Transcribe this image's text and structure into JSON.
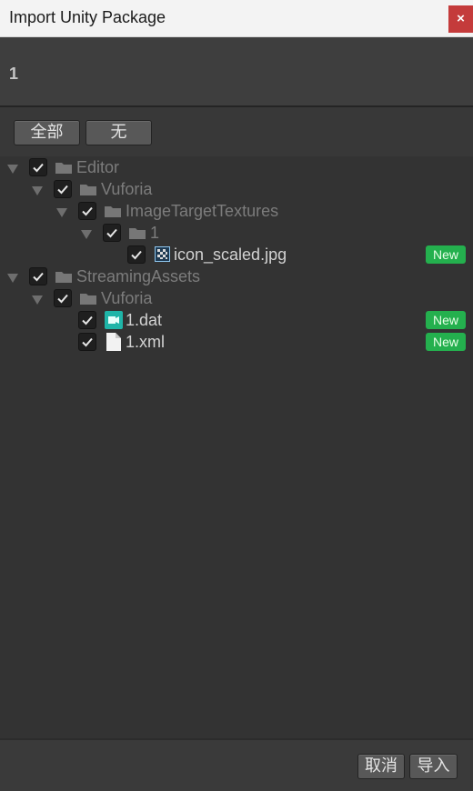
{
  "window": {
    "title": "Import Unity Package",
    "close_label": "×"
  },
  "header": {
    "package_name": "1"
  },
  "select": {
    "all_label": "全部",
    "none_label": "无"
  },
  "tree": {
    "items": [
      {
        "label": "Editor",
        "type": "folder",
        "checked": true
      },
      {
        "label": "Vuforia",
        "type": "folder",
        "checked": true
      },
      {
        "label": "ImageTargetTextures",
        "type": "folder",
        "checked": true
      },
      {
        "label": "1",
        "type": "folder",
        "checked": true
      },
      {
        "label": "icon_scaled.jpg",
        "type": "image",
        "checked": true,
        "badge": "New"
      },
      {
        "label": "StreamingAssets",
        "type": "folder",
        "checked": true
      },
      {
        "label": "Vuforia",
        "type": "folder",
        "checked": true
      },
      {
        "label": "1.dat",
        "type": "dat",
        "checked": true,
        "badge": "New"
      },
      {
        "label": "1.xml",
        "type": "document",
        "checked": true,
        "badge": "New"
      }
    ]
  },
  "footer": {
    "cancel_label": "取消",
    "import_label": "导入"
  },
  "colors": {
    "new_badge": "#24b04e",
    "close_button": "#c43b3b",
    "dat_icon": "#1fb5a8"
  }
}
